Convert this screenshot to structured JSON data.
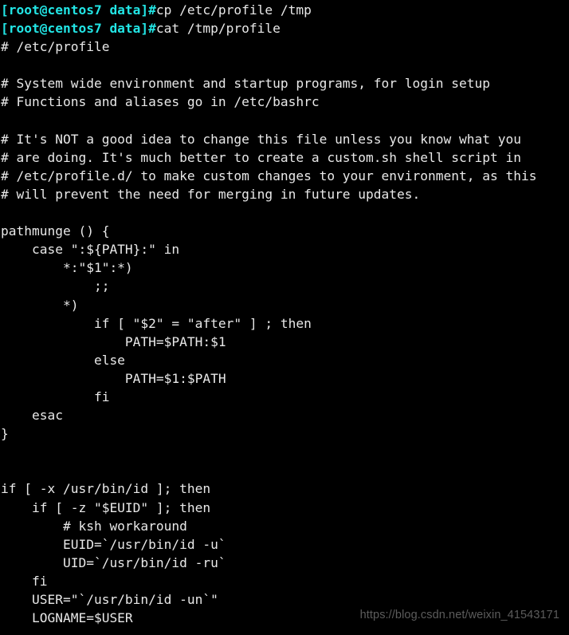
{
  "terminal": {
    "background_color": "#000000",
    "foreground_color": "#e8e8e8",
    "prompt_color": "#22e5e5",
    "prompt_text": "[root@centos7 data]#",
    "commands": [
      "cp /etc/profile /tmp",
      "cat /tmp/profile"
    ],
    "output_lines": [
      "# /etc/profile",
      "",
      "# System wide environment and startup programs, for login setup",
      "# Functions and aliases go in /etc/bashrc",
      "",
      "# It's NOT a good idea to change this file unless you know what you",
      "# are doing. It's much better to create a custom.sh shell script in",
      "# /etc/profile.d/ to make custom changes to your environment, as this",
      "# will prevent the need for merging in future updates.",
      "",
      "pathmunge () {",
      "    case \":${PATH}:\" in",
      "        *:\"$1\":*)",
      "            ;;",
      "        *)",
      "            if [ \"$2\" = \"after\" ] ; then",
      "                PATH=$PATH:$1",
      "            else",
      "                PATH=$1:$PATH",
      "            fi",
      "    esac",
      "}",
      "",
      "",
      "if [ -x /usr/bin/id ]; then",
      "    if [ -z \"$EUID\" ]; then",
      "        # ksh workaround",
      "        EUID=`/usr/bin/id -u`",
      "        UID=`/usr/bin/id -ru`",
      "    fi",
      "    USER=\"`/usr/bin/id -un`\"",
      "    LOGNAME=$USER"
    ]
  },
  "watermark": {
    "text": "https://blog.csdn.net/weixin_41543171",
    "color": "#5c5c5c"
  }
}
